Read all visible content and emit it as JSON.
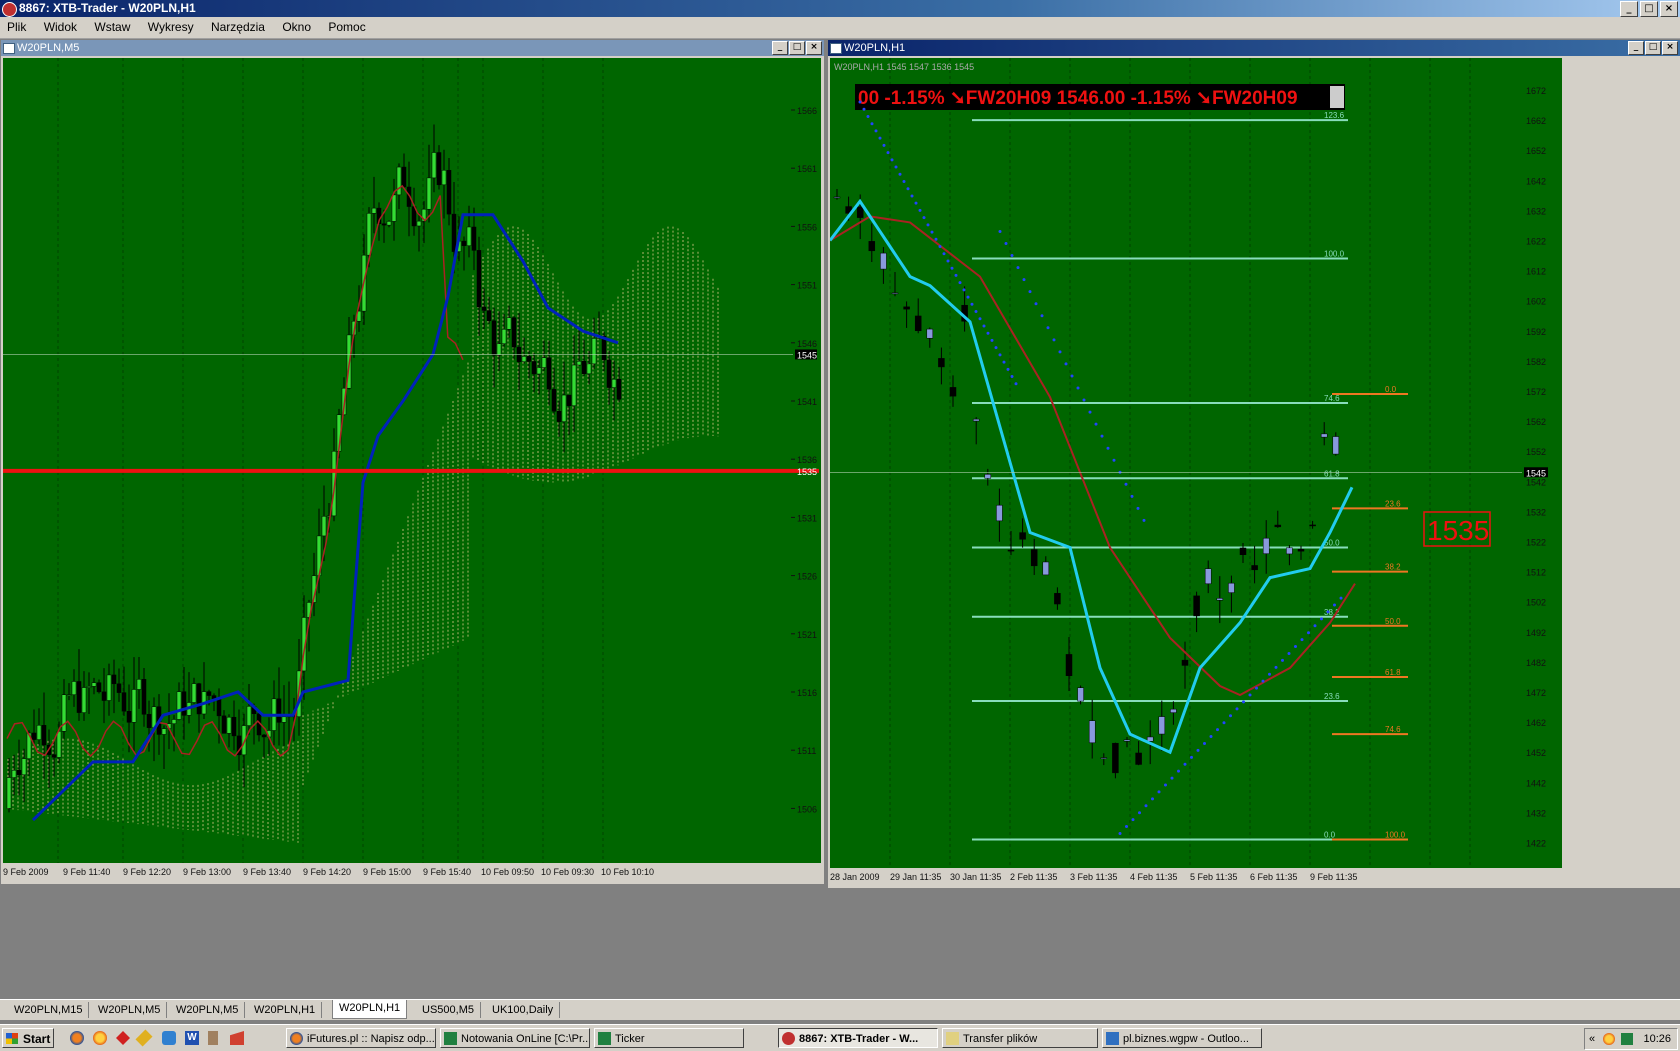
{
  "app": {
    "title": "8867: XTB-Trader - W20PLN,H1"
  },
  "menu": [
    "Plik",
    "Widok",
    "Wstaw",
    "Wykresy",
    "Narzędzia",
    "Okno",
    "Pomoc"
  ],
  "colors": {
    "chart_bg": "#006600",
    "bull": "#33dd33",
    "bear": "#000000",
    "ma_blue": "#0022bb",
    "ma_red": "#aa2222",
    "cyan": "#22ccee",
    "support": "#ee1111",
    "fib": "#88ddbb",
    "fib_orange": "#ee7722",
    "ichimoku": "#ddcc88"
  },
  "left_chart": {
    "title": "W20PLN,M5",
    "price_labels": [
      "1566",
      "1561",
      "1556",
      "1551",
      "1546",
      "1541",
      "1536",
      "1531",
      "1526",
      "1521",
      "1516",
      "1511",
      "1506"
    ],
    "current_price": "1545",
    "support_price": "1535",
    "time_labels": [
      "9 Feb 2009",
      "9 Feb 11:40",
      "9 Feb 12:20",
      "9 Feb 13:00",
      "9 Feb 13:40",
      "9 Feb 14:20",
      "9 Feb 15:00",
      "9 Feb 15:40",
      "10 Feb 09:50",
      "10 Feb 09:30",
      "10 Feb 10:10"
    ]
  },
  "right_chart": {
    "title": "W20PLN,H1",
    "info": "W20PLN,H1  1545 1547 1536 1545",
    "ticker": "00 -1.15%   ➘FW20H09 1546.00 -1.15%   ➘FW20H09",
    "price_labels": [
      "1672",
      "1662",
      "1652",
      "1642",
      "1632",
      "1622",
      "1612",
      "1602",
      "1592",
      "1582",
      "1572",
      "1562",
      "1552",
      "1542",
      "1532",
      "1522",
      "1512",
      "1502",
      "1492",
      "1482",
      "1472",
      "1462",
      "1452",
      "1442",
      "1432",
      "1422"
    ],
    "current_price": "1545",
    "big_label": "1535",
    "fib_left": [
      "123.6",
      "100.0",
      "74.6",
      "61.8",
      "50.0",
      "38.2",
      "23.6",
      "0.0"
    ],
    "fib_right": [
      "0.0",
      "23.6",
      "38.2",
      "50.0",
      "61.8",
      "74.6",
      "100.0"
    ],
    "time_labels": [
      "28 Jan 2009",
      "29 Jan 11:35",
      "30 Jan 11:35",
      "2 Feb 11:35",
      "3 Feb 11:35",
      "4 Feb 11:35",
      "5 Feb 11:35",
      "6 Feb 11:35",
      "9 Feb 11:35"
    ]
  },
  "tabs": [
    {
      "label": "W20PLN,M15",
      "active": false
    },
    {
      "label": "W20PLN,M5",
      "active": false
    },
    {
      "label": "W20PLN,M5",
      "active": false
    },
    {
      "label": "W20PLN,H1",
      "active": false
    },
    {
      "label": "W20PLN,H1",
      "active": true
    },
    {
      "label": "US500,M5",
      "active": false
    },
    {
      "label": "UK100,Daily",
      "active": false
    }
  ],
  "taskbar": {
    "start": "Start",
    "buttons": [
      {
        "label": "iFutures.pl :: Napisz odp...",
        "pressed": false
      },
      {
        "label": "Notowania OnLine [C:\\Pr...",
        "pressed": false
      },
      {
        "label": "Ticker",
        "pressed": false
      },
      {
        "label": "8867: XTB-Trader - W...",
        "pressed": true
      },
      {
        "label": "Transfer plików",
        "pressed": false
      },
      {
        "label": "pl.biznes.wgpw - Outloo...",
        "pressed": false
      }
    ],
    "clock": "10:26"
  }
}
